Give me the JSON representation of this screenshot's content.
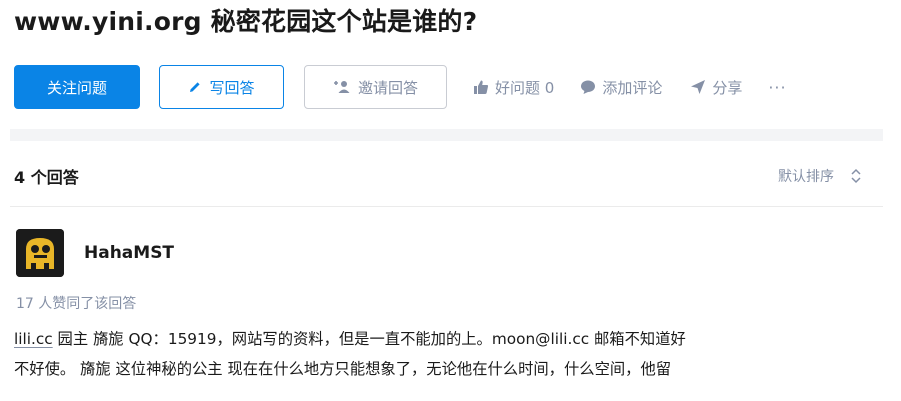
{
  "question": {
    "title": "www.yini.org 秘密花园这个站是谁的?"
  },
  "actions": {
    "follow_label": "关注问题",
    "write_answer_label": "写回答",
    "invite_label": "邀请回答",
    "good_question_label": "好问题 0",
    "add_comment_label": "添加评论",
    "share_label": "分享",
    "more_label": "···"
  },
  "answers": {
    "count_label": "4 个回答",
    "sort_label": "默认排序"
  },
  "answer": {
    "author_name": "HahaMST",
    "votes_text": "17 人赞同了该回答",
    "line1_link": "lili.cc",
    "line1_rest": " 园主 旖旎 QQ：15919，网站写的资料，但是一直不能加的上。moon@lili.cc 邮箱不知道好",
    "line2": "不好使。 旖旎 这位神秘的公主 现在在什么地方只能想象了，无论他在什么时间，什么空间，他留"
  },
  "colors": {
    "primary": "#0a84e6",
    "muted": "#8590a6",
    "text": "#1a1a1a",
    "band": "#f3f4f6"
  },
  "icons": {
    "write": "pencil-icon",
    "invite": "add-user-icon",
    "like": "thumb-up-icon",
    "comment": "comment-bubble-icon",
    "share": "paper-plane-icon",
    "sort": "sort-updown-icon"
  }
}
